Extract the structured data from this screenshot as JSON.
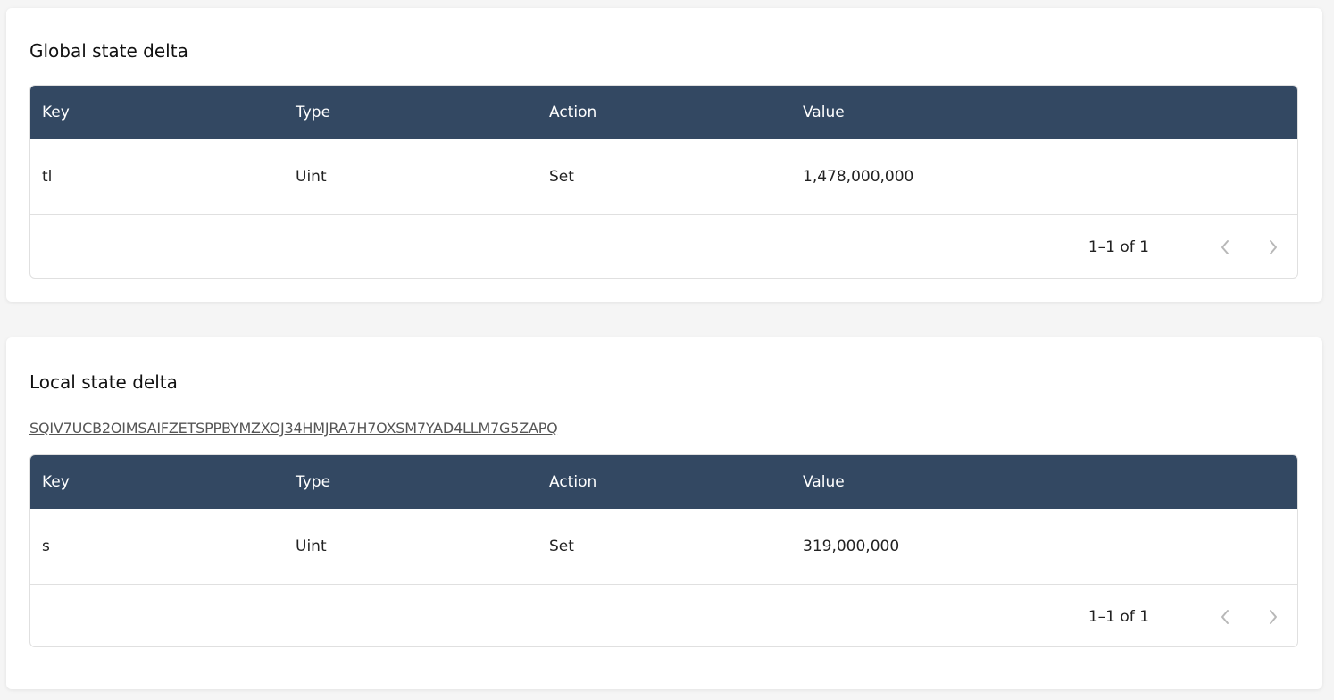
{
  "global_section": {
    "title": "Global state delta",
    "table": {
      "headers": [
        "Key",
        "Type",
        "Action",
        "Value"
      ],
      "rows": [
        {
          "key": "tl",
          "type": "Uint",
          "action": "Set",
          "value": "1,478,000,000"
        }
      ],
      "pagination": "1–1 of 1"
    }
  },
  "local_section": {
    "title": "Local state delta",
    "address": "SQIV7UCB2OIMSAIFZETSPPBYMZXOJ34HMJRA7H7OXSM7YAD4LLM7G5ZAPQ",
    "table": {
      "headers": [
        "Key",
        "Type",
        "Action",
        "Value"
      ],
      "rows": [
        {
          "key": "s",
          "type": "Uint",
          "action": "Set",
          "value": "319,000,000"
        }
      ],
      "pagination": "1–1 of 1"
    }
  },
  "colors": {
    "header_bg": "#334862",
    "pager_disabled": "#b8b8b8"
  },
  "icons": {
    "prev": "chevron-left-icon",
    "next": "chevron-right-icon"
  }
}
